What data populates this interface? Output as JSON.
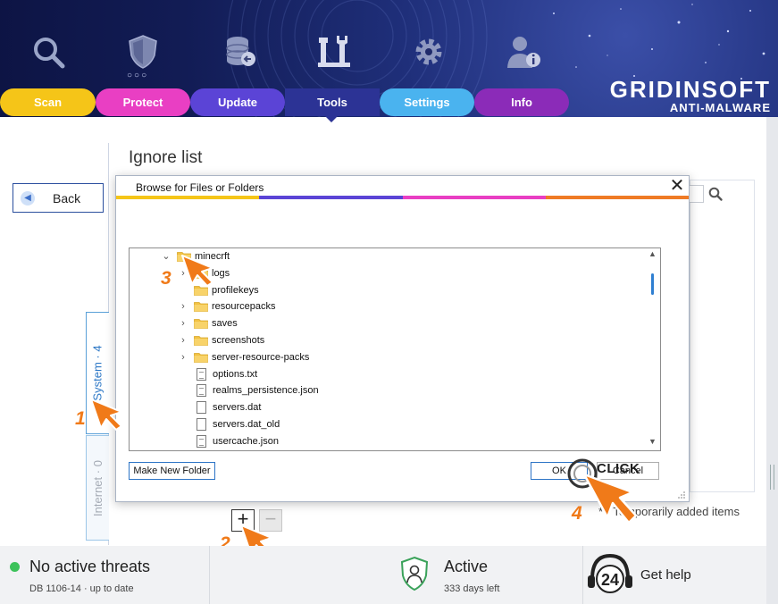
{
  "brand": {
    "name": "GRIDINSOFT",
    "sub": "ANTI-MALWARE"
  },
  "header": {
    "shield_dots": "○○○"
  },
  "tabs": [
    {
      "label": "Scan"
    },
    {
      "label": "Protect"
    },
    {
      "label": "Update"
    },
    {
      "label": "Tools"
    },
    {
      "label": "Settings"
    },
    {
      "label": "Info"
    }
  ],
  "left": {
    "back_label": "Back",
    "tab_system": "System · 4",
    "tab_internet": "Internet · 0"
  },
  "main": {
    "title": "Ignore list",
    "temp_note": "* - Temporarily added items",
    "add_label": "+",
    "remove_label": "−"
  },
  "dialog": {
    "title": "Browse for Files or Folders",
    "close_label": "✕",
    "colorbar": [
      "#f5c518",
      "#5b44d6",
      "#e93fc3",
      "#ef7b25"
    ],
    "tree": {
      "root": {
        "label": "minecrft",
        "expanded": true
      },
      "items": [
        {
          "label": "logs",
          "kind": "folder",
          "expandable": true
        },
        {
          "label": "profilekeys",
          "kind": "folder",
          "expandable": false
        },
        {
          "label": "resourcepacks",
          "kind": "folder",
          "expandable": true
        },
        {
          "label": "saves",
          "kind": "folder",
          "expandable": true
        },
        {
          "label": "screenshots",
          "kind": "folder",
          "expandable": true
        },
        {
          "label": "server-resource-packs",
          "kind": "folder",
          "expandable": true
        },
        {
          "label": "options.txt",
          "kind": "file",
          "expandable": false
        },
        {
          "label": "realms_persistence.json",
          "kind": "file",
          "expandable": false
        },
        {
          "label": "servers.dat",
          "kind": "file",
          "expandable": false
        },
        {
          "label": "servers.dat_old",
          "kind": "file",
          "expandable": false
        },
        {
          "label": "usercache.json",
          "kind": "file",
          "expandable": false
        }
      ]
    },
    "new_folder_label": "Make New Folder",
    "ok_label": "OK",
    "cancel_label": "Cancel"
  },
  "annotations": {
    "step1": "1",
    "step2": "2",
    "step3": "3",
    "step4": "4",
    "click_label": "CLICK",
    "arrow_color": "#f07a19"
  },
  "footer": {
    "threat_status": "No active threats",
    "db_status": "DB 1106-14 · up to date",
    "protection_status": "Active",
    "days_left": "333 days left",
    "support_badge": "24",
    "help_label": "Get help",
    "status_color": "#3cc25a"
  }
}
